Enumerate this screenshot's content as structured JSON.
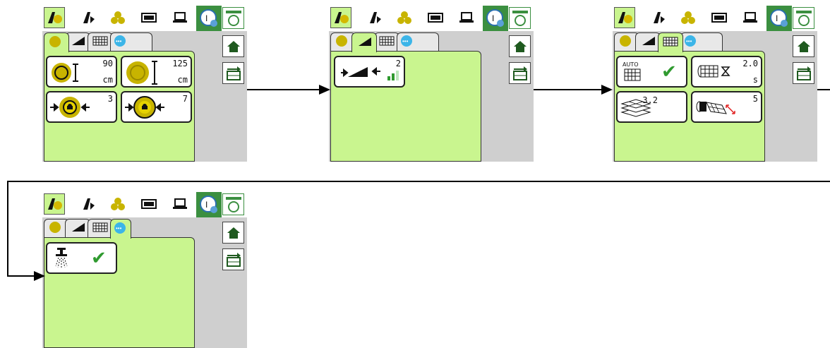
{
  "toolbar": {
    "icons": [
      "tractor-baler-icon",
      "baler-icon",
      "bales-icon",
      "screen-icon",
      "laptop-icon",
      "clock-gear-icon",
      "counter-reset-icon"
    ]
  },
  "side": {
    "icons": [
      "home-icon",
      "menu-arrow-icon"
    ]
  },
  "tabs": {
    "icons": [
      "bale-tab-icon",
      "knife-tab-icon",
      "net-tab-icon",
      "more-tab-icon"
    ]
  },
  "screens": [
    {
      "active_tab": 0,
      "tiles": [
        {
          "icon": "bale-diameter-small-icon",
          "value": "90",
          "unit": "cm"
        },
        {
          "icon": "bale-diameter-large-icon",
          "value": "125",
          "unit": "cm"
        },
        {
          "icon": "bale-density-core-icon",
          "value": "3",
          "unit": ""
        },
        {
          "icon": "bale-density-outer-icon",
          "value": "7",
          "unit": ""
        }
      ]
    },
    {
      "active_tab": 1,
      "tiles": [
        {
          "icon": "knives-icon",
          "value": "2",
          "unit": "",
          "indicator": "signal-bars-icon"
        }
      ]
    },
    {
      "active_tab": 2,
      "tiles": [
        {
          "icon": "net-auto-icon",
          "value": "",
          "unit": "",
          "label": "AUTO",
          "status": "✔"
        },
        {
          "icon": "net-delay-icon",
          "value": "2.0",
          "unit": "s"
        },
        {
          "icon": "net-layers-icon",
          "value": "3.2",
          "unit": ""
        },
        {
          "icon": "net-wrap-icon",
          "value": "5",
          "unit": ""
        }
      ]
    },
    {
      "active_tab": 3,
      "tiles": [
        {
          "icon": "sprayer-icon",
          "value": "",
          "unit": "",
          "status": "✔"
        }
      ]
    }
  ]
}
